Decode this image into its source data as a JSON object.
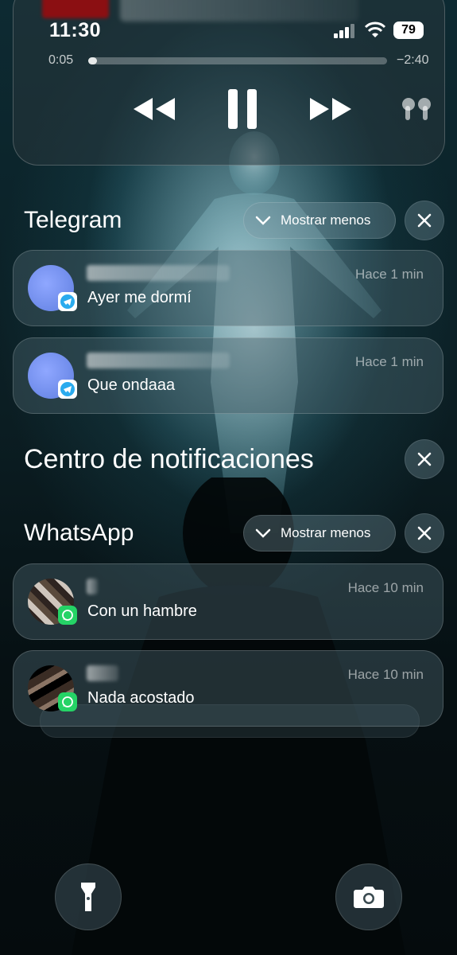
{
  "status_bar": {
    "time": "11:30",
    "battery": "79"
  },
  "media": {
    "elapsed": "0:05",
    "remaining": "−2:40",
    "progress": 0.03,
    "icons": [
      "rewind-icon",
      "pause-icon",
      "fast-forward-icon",
      "airpods-icon"
    ]
  },
  "telegram": {
    "title": "Telegram",
    "collapse_label": "Mostrar menos",
    "accent": "#2AABEE",
    "notifications": [
      {
        "message": "Ayer me dormí",
        "time": "Hace 1 min"
      },
      {
        "message": "Que ondaaa",
        "time": "Hace 1 min"
      }
    ]
  },
  "notification_center": {
    "title": "Centro de notificaciones"
  },
  "whatsapp": {
    "title": "WhatsApp",
    "collapse_label": "Mostrar menos",
    "accent": "#25D366",
    "notifications": [
      {
        "message": "Con un hambre",
        "time": "Hace 10 min"
      },
      {
        "message": "Nada acostado",
        "time": "Hace 10 min"
      }
    ]
  },
  "bottom": {
    "icons": [
      "flashlight-icon",
      "camera-icon"
    ]
  }
}
